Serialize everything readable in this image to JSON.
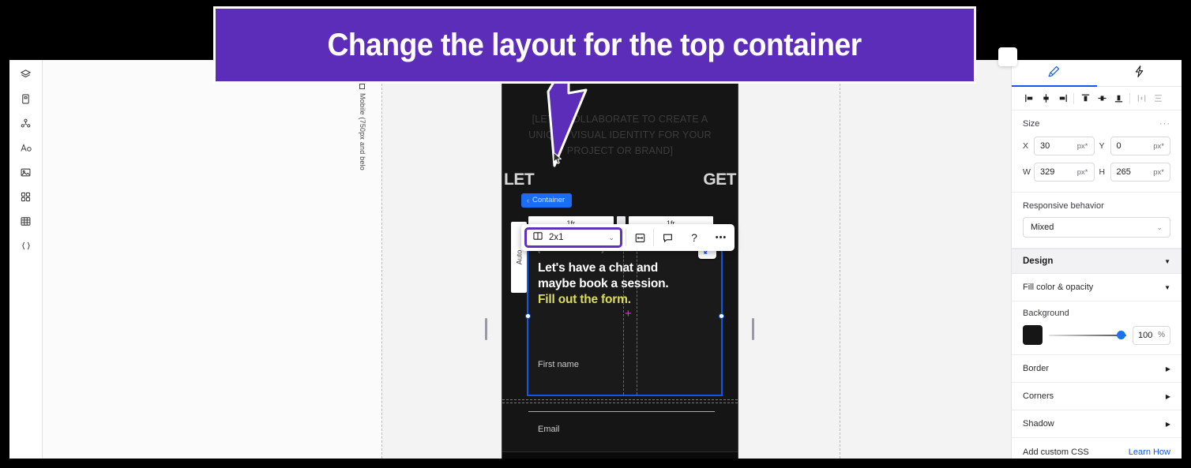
{
  "banner": {
    "text": "Change the layout for the top container",
    "bg": "#5b2db8"
  },
  "left_rail": {
    "items": [
      {
        "name": "layers-icon",
        "label": "Layers"
      },
      {
        "name": "pages-icon",
        "label": "Pages"
      },
      {
        "name": "site-structure-icon",
        "label": "Site structure"
      },
      {
        "name": "text-icon",
        "label": "Text"
      },
      {
        "name": "image-icon",
        "label": "Image"
      },
      {
        "name": "apps-icon",
        "label": "Apps"
      },
      {
        "name": "table-icon",
        "label": "Table"
      },
      {
        "name": "code-icon",
        "label": "Custom code"
      }
    ]
  },
  "canvas": {
    "breakpoint_label": "Mobile (750px and belo",
    "hero_copy": "[LET'S COLLABORATE TO CREATE A UNIQUE VISUAL IDENTITY FOR YOUR PROJECT OR BRAND]",
    "big_word_left": "LET",
    "big_word_right": "GET",
    "container_chip": "Container",
    "container_chip_chevron": "‹",
    "grid_tracks": [
      "1fr",
      "1fr"
    ],
    "auto_rail_label": "Auto",
    "selection": {
      "eyebrow": "[CONTACT ME]",
      "headline_line1": "Let's have a chat and",
      "headline_line2": "maybe book a session.",
      "headline_accent": "Fill out the form.",
      "field_first_name": "First name",
      "field_email": "Email"
    }
  },
  "element_toolbar": {
    "layout_value": "2x1",
    "layout_chevron": "⌄",
    "buttons": [
      {
        "name": "spacing-icon",
        "label": "Spacing"
      },
      {
        "name": "comment-icon",
        "label": "Comment"
      },
      {
        "name": "help-icon",
        "label": "?"
      },
      {
        "name": "more-options-icon",
        "label": "•••"
      }
    ]
  },
  "inspector": {
    "tabs": [
      {
        "name": "design-tab",
        "label": "Design",
        "active": true
      },
      {
        "name": "interactions-tab",
        "label": "Interactions",
        "active": false
      }
    ],
    "align_buttons": [
      "align-left-icon",
      "align-center-horizontal-icon",
      "align-right-icon",
      "align-top-icon",
      "align-middle-vertical-icon",
      "align-bottom-icon",
      "distribute-horizontal-icon",
      "distribute-vertical-icon"
    ],
    "size": {
      "title": "Size",
      "more": "···",
      "fields": [
        {
          "key": "X",
          "value": "30",
          "unit": "px*"
        },
        {
          "key": "Y",
          "value": "0",
          "unit": "px*"
        },
        {
          "key": "W",
          "value": "329",
          "unit": "px*"
        },
        {
          "key": "H",
          "value": "265",
          "unit": "px*"
        }
      ]
    },
    "responsive": {
      "label": "Responsive behavior",
      "value": "Mixed",
      "chevron": "⌄"
    },
    "design": {
      "title": "Design",
      "chevron": "▼",
      "fill": {
        "label": "Fill color & opacity",
        "chevron": "▼"
      },
      "background": {
        "label": "Background",
        "color": "#161616",
        "opacity": "100",
        "unit": "%"
      },
      "rows": [
        {
          "label": "Border",
          "chevron": "▶"
        },
        {
          "label": "Corners",
          "chevron": "▶"
        },
        {
          "label": "Shadow",
          "chevron": "▶"
        }
      ],
      "custom_css": {
        "label": "Add custom CSS",
        "link": "Learn How"
      }
    }
  }
}
